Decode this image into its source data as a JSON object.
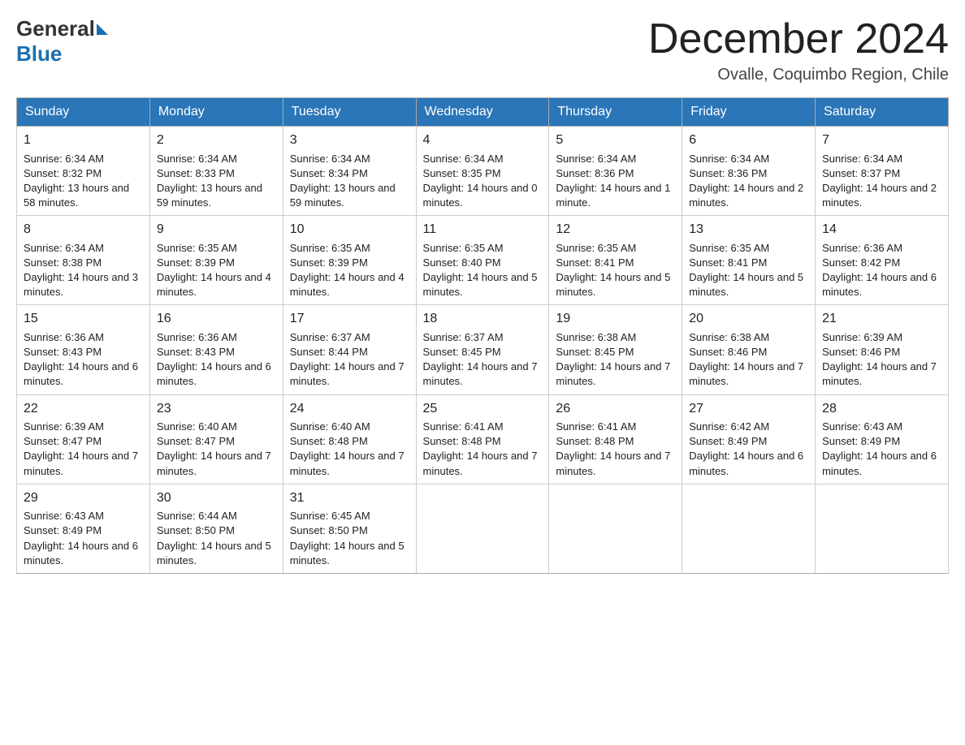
{
  "logo": {
    "general": "General",
    "blue": "Blue"
  },
  "header": {
    "month": "December 2024",
    "location": "Ovalle, Coquimbo Region, Chile"
  },
  "days": [
    "Sunday",
    "Monday",
    "Tuesday",
    "Wednesday",
    "Thursday",
    "Friday",
    "Saturday"
  ],
  "weeks": [
    [
      {
        "day": 1,
        "sunrise": "6:34 AM",
        "sunset": "8:32 PM",
        "daylight": "13 hours and 58 minutes."
      },
      {
        "day": 2,
        "sunrise": "6:34 AM",
        "sunset": "8:33 PM",
        "daylight": "13 hours and 59 minutes."
      },
      {
        "day": 3,
        "sunrise": "6:34 AM",
        "sunset": "8:34 PM",
        "daylight": "13 hours and 59 minutes."
      },
      {
        "day": 4,
        "sunrise": "6:34 AM",
        "sunset": "8:35 PM",
        "daylight": "14 hours and 0 minutes."
      },
      {
        "day": 5,
        "sunrise": "6:34 AM",
        "sunset": "8:36 PM",
        "daylight": "14 hours and 1 minute."
      },
      {
        "day": 6,
        "sunrise": "6:34 AM",
        "sunset": "8:36 PM",
        "daylight": "14 hours and 2 minutes."
      },
      {
        "day": 7,
        "sunrise": "6:34 AM",
        "sunset": "8:37 PM",
        "daylight": "14 hours and 2 minutes."
      }
    ],
    [
      {
        "day": 8,
        "sunrise": "6:34 AM",
        "sunset": "8:38 PM",
        "daylight": "14 hours and 3 minutes."
      },
      {
        "day": 9,
        "sunrise": "6:35 AM",
        "sunset": "8:39 PM",
        "daylight": "14 hours and 4 minutes."
      },
      {
        "day": 10,
        "sunrise": "6:35 AM",
        "sunset": "8:39 PM",
        "daylight": "14 hours and 4 minutes."
      },
      {
        "day": 11,
        "sunrise": "6:35 AM",
        "sunset": "8:40 PM",
        "daylight": "14 hours and 5 minutes."
      },
      {
        "day": 12,
        "sunrise": "6:35 AM",
        "sunset": "8:41 PM",
        "daylight": "14 hours and 5 minutes."
      },
      {
        "day": 13,
        "sunrise": "6:35 AM",
        "sunset": "8:41 PM",
        "daylight": "14 hours and 5 minutes."
      },
      {
        "day": 14,
        "sunrise": "6:36 AM",
        "sunset": "8:42 PM",
        "daylight": "14 hours and 6 minutes."
      }
    ],
    [
      {
        "day": 15,
        "sunrise": "6:36 AM",
        "sunset": "8:43 PM",
        "daylight": "14 hours and 6 minutes."
      },
      {
        "day": 16,
        "sunrise": "6:36 AM",
        "sunset": "8:43 PM",
        "daylight": "14 hours and 6 minutes."
      },
      {
        "day": 17,
        "sunrise": "6:37 AM",
        "sunset": "8:44 PM",
        "daylight": "14 hours and 7 minutes."
      },
      {
        "day": 18,
        "sunrise": "6:37 AM",
        "sunset": "8:45 PM",
        "daylight": "14 hours and 7 minutes."
      },
      {
        "day": 19,
        "sunrise": "6:38 AM",
        "sunset": "8:45 PM",
        "daylight": "14 hours and 7 minutes."
      },
      {
        "day": 20,
        "sunrise": "6:38 AM",
        "sunset": "8:46 PM",
        "daylight": "14 hours and 7 minutes."
      },
      {
        "day": 21,
        "sunrise": "6:39 AM",
        "sunset": "8:46 PM",
        "daylight": "14 hours and 7 minutes."
      }
    ],
    [
      {
        "day": 22,
        "sunrise": "6:39 AM",
        "sunset": "8:47 PM",
        "daylight": "14 hours and 7 minutes."
      },
      {
        "day": 23,
        "sunrise": "6:40 AM",
        "sunset": "8:47 PM",
        "daylight": "14 hours and 7 minutes."
      },
      {
        "day": 24,
        "sunrise": "6:40 AM",
        "sunset": "8:48 PM",
        "daylight": "14 hours and 7 minutes."
      },
      {
        "day": 25,
        "sunrise": "6:41 AM",
        "sunset": "8:48 PM",
        "daylight": "14 hours and 7 minutes."
      },
      {
        "day": 26,
        "sunrise": "6:41 AM",
        "sunset": "8:48 PM",
        "daylight": "14 hours and 7 minutes."
      },
      {
        "day": 27,
        "sunrise": "6:42 AM",
        "sunset": "8:49 PM",
        "daylight": "14 hours and 6 minutes."
      },
      {
        "day": 28,
        "sunrise": "6:43 AM",
        "sunset": "8:49 PM",
        "daylight": "14 hours and 6 minutes."
      }
    ],
    [
      {
        "day": 29,
        "sunrise": "6:43 AM",
        "sunset": "8:49 PM",
        "daylight": "14 hours and 6 minutes."
      },
      {
        "day": 30,
        "sunrise": "6:44 AM",
        "sunset": "8:50 PM",
        "daylight": "14 hours and 5 minutes."
      },
      {
        "day": 31,
        "sunrise": "6:45 AM",
        "sunset": "8:50 PM",
        "daylight": "14 hours and 5 minutes."
      },
      null,
      null,
      null,
      null
    ]
  ],
  "labels": {
    "sunrise": "Sunrise:",
    "sunset": "Sunset:",
    "daylight": "Daylight:"
  }
}
